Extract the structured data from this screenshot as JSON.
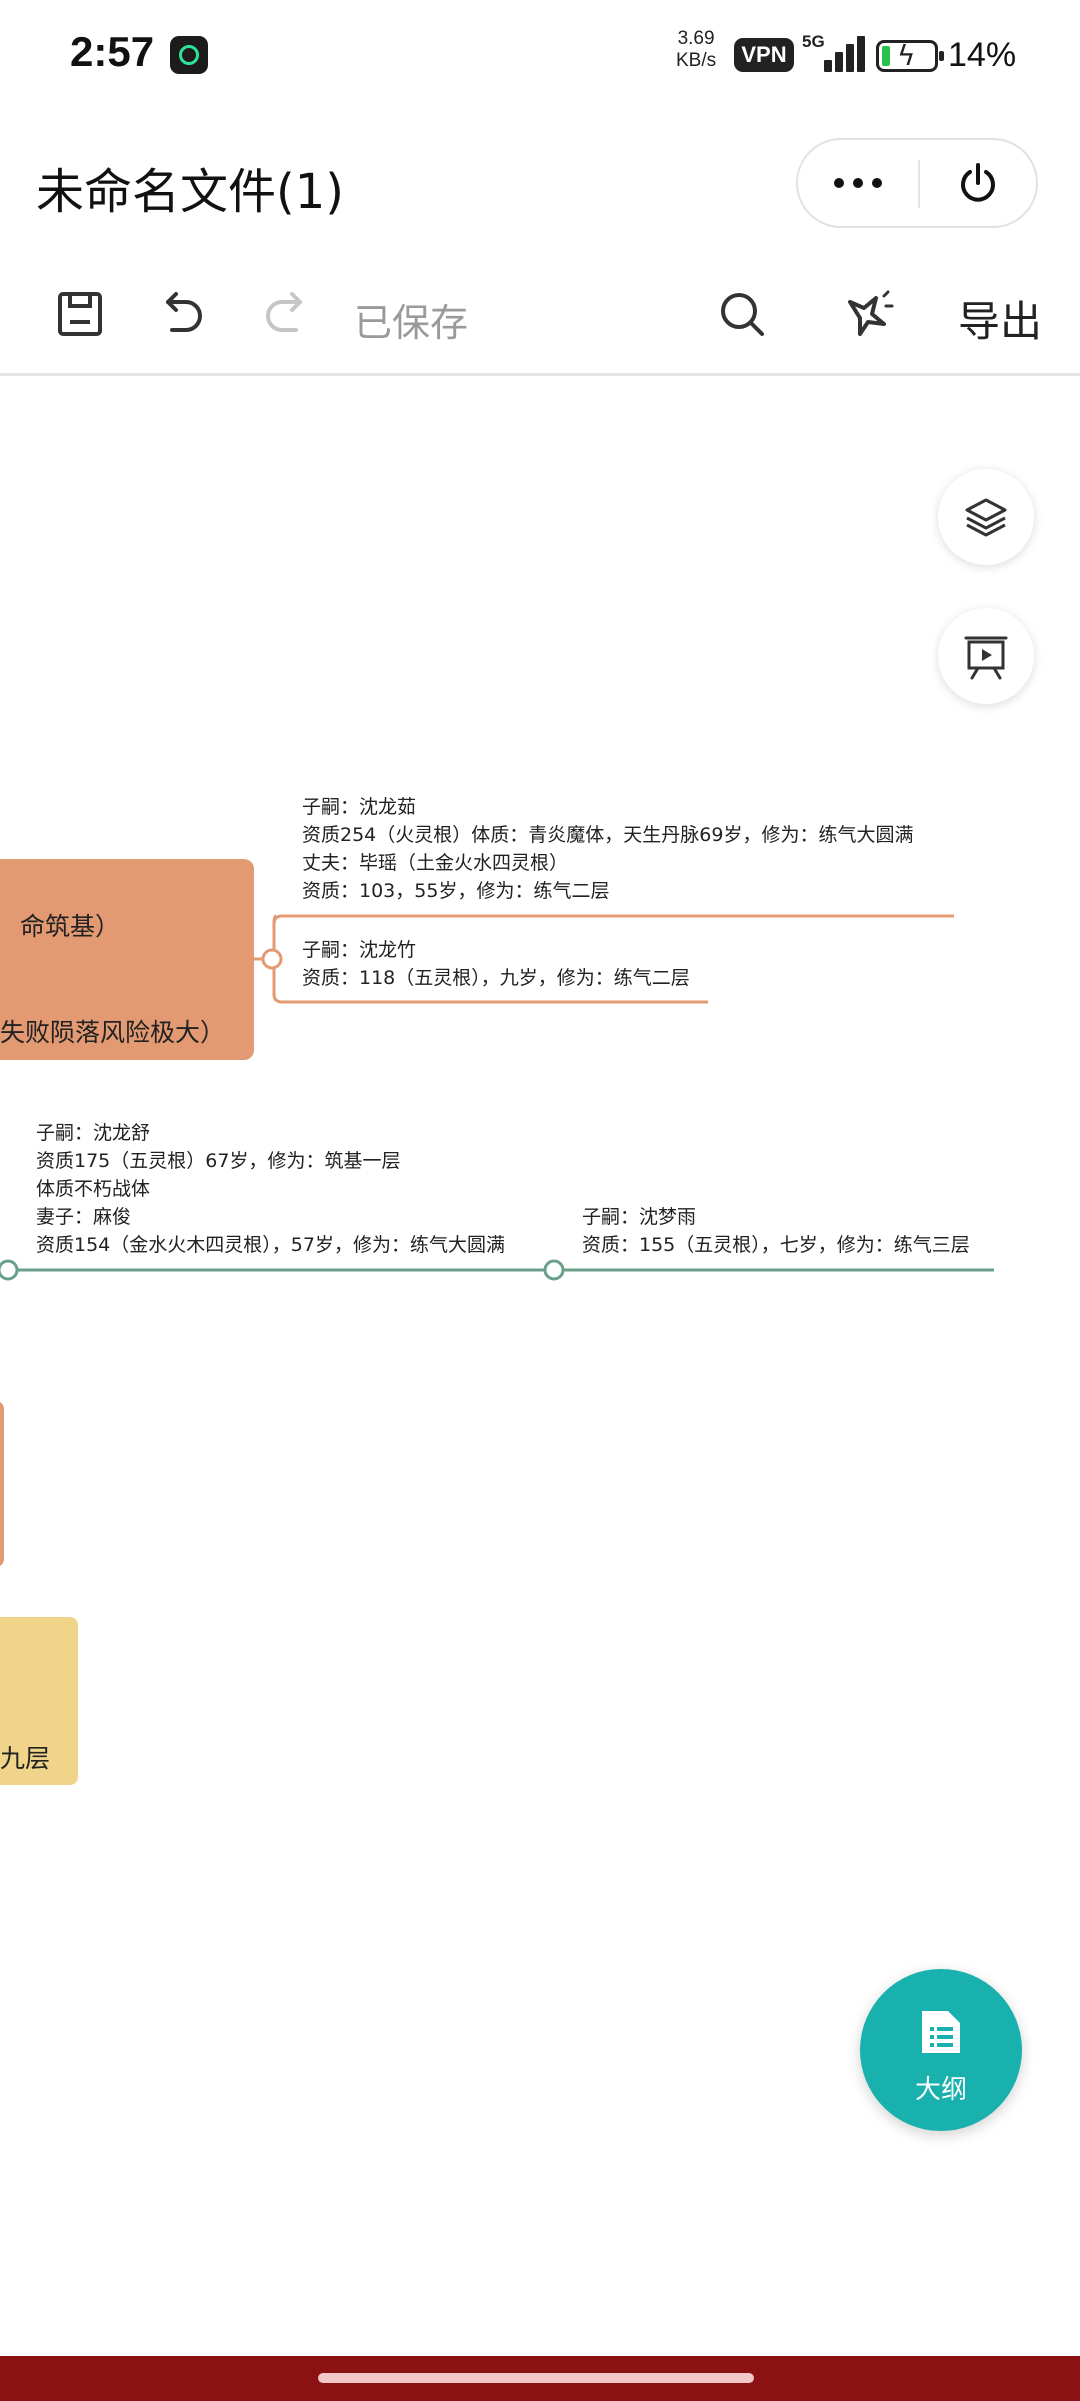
{
  "status": {
    "time": "2:57",
    "net_speed_value": "3.69",
    "net_speed_unit": "KB/s",
    "vpn": "VPN",
    "network": "5G",
    "battery_pct": "14%",
    "battery_level": 0.14
  },
  "header": {
    "title": "未命名文件(1)",
    "more_icon": "more-dots-icon",
    "power_icon": "power-icon"
  },
  "toolbar": {
    "save_icon": "save-icon",
    "undo_icon": "undo-icon",
    "redo_icon": "redo-icon",
    "saved_label": "已保存",
    "search_icon": "search-icon",
    "style_icon": "magic-style-icon",
    "export_label": "导出"
  },
  "canvas": {
    "node_main_line1": "命筑基）",
    "node_main_line2": "失败陨落风险极大）",
    "node_yellow_text": "九层",
    "block_a": [
      "子嗣：沈龙茹",
      "资质254（火灵根）体质：青炎魔体，天生丹脉69岁，修为：练气大圆满",
      "丈夫：毕瑶（土金火水四灵根）",
      "资质：103，55岁，修为：练气二层"
    ],
    "block_b": [
      "子嗣：沈龙竹",
      "资质：118（五灵根），九岁，修为：练气二层"
    ],
    "block_c": [
      "子嗣：沈龙舒",
      "资质175（五灵根）67岁，修为：筑基一层",
      "体质不朽战体",
      "妻子：麻俊",
      "资质154（金水火木四灵根），57岁，修为：练气大圆满"
    ],
    "block_d": [
      "子嗣：沈梦雨",
      "资质：155（五灵根），七岁，修为：练气三层"
    ],
    "accent_orange": "#e39a73",
    "accent_green": "#6aa08a",
    "accent_yellow": "#f0d48a"
  },
  "outline_fab": {
    "label": "大纲",
    "icon": "outline-doc-icon",
    "color": "#19b1ad"
  },
  "floating": {
    "layers_icon": "layers-icon",
    "present_icon": "presentation-icon"
  }
}
